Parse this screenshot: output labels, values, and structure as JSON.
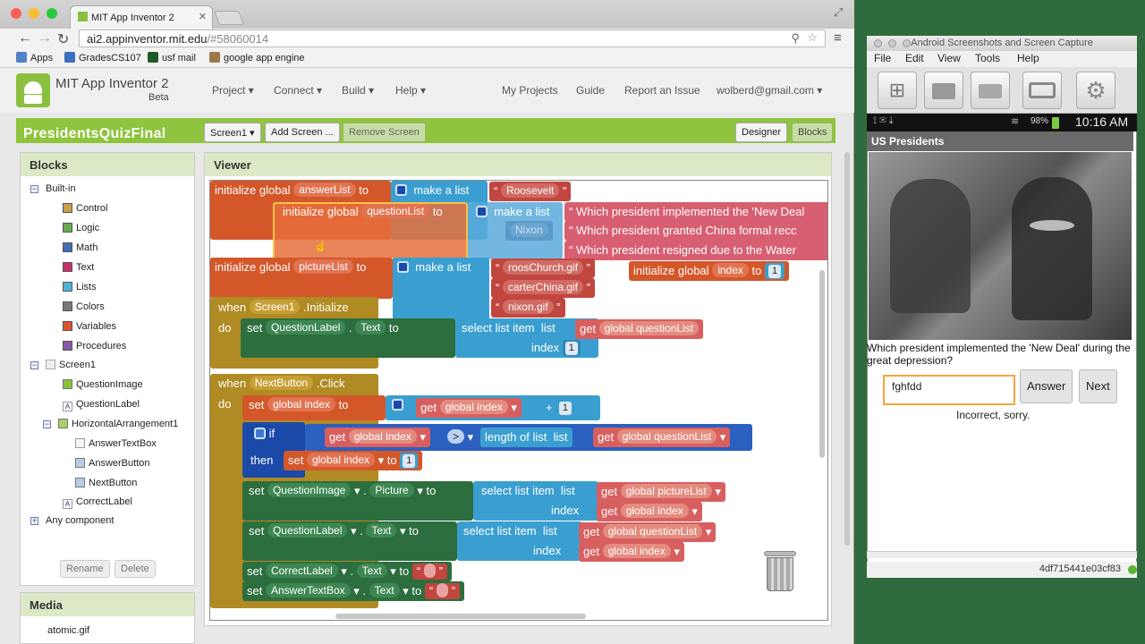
{
  "browser": {
    "tab_title": "MIT App Inventor 2",
    "url_host": "ai2.appinventor.mit.edu",
    "url_path": "/#58060014",
    "bookmarks": [
      "Apps",
      "GradesCS107",
      "usf mail",
      "google app engine"
    ]
  },
  "app": {
    "logo_title": "MIT App Inventor 2",
    "logo_beta": "Beta",
    "menus": [
      "Project ▾",
      "Connect ▾",
      "Build ▾",
      "Help ▾"
    ],
    "links": [
      "My Projects",
      "Guide",
      "Report an Issue",
      "wolberd@gmail.com ▾"
    ]
  },
  "project": {
    "name": "PresidentsQuizFinal",
    "screen_select": "Screen1 ▾",
    "add_screen": "Add Screen ...",
    "remove_screen": "Remove Screen",
    "designer": "Designer",
    "blocks": "Blocks"
  },
  "blocks_panel": {
    "title": "Blocks",
    "builtin": "Built-in",
    "builtin_items": [
      {
        "label": "Control",
        "color": "#c8a04a"
      },
      {
        "label": "Logic",
        "color": "#6aa84f"
      },
      {
        "label": "Math",
        "color": "#3f6fb5"
      },
      {
        "label": "Text",
        "color": "#c8316b"
      },
      {
        "label": "Lists",
        "color": "#4fb1d6"
      },
      {
        "label": "Colors",
        "color": "#7a7a7a"
      },
      {
        "label": "Variables",
        "color": "#d8542a"
      },
      {
        "label": "Procedures",
        "color": "#8a5aa6"
      }
    ],
    "screen": "Screen1",
    "components": [
      "QuestionImage",
      "QuestionLabel",
      "HorizontalArrangement1",
      "AnswerTextBox",
      "AnswerButton",
      "NextButton",
      "CorrectLabel"
    ],
    "any_component": "Any component",
    "rename": "Rename",
    "delete": "Delete"
  },
  "media_panel": {
    "title": "Media",
    "items": [
      "atomic.gif"
    ]
  },
  "viewer": {
    "title": "Viewer",
    "blocks": {
      "init_answer": "initialize global",
      "answer_var": "answerList",
      "to": "to",
      "make_list": "make a list",
      "roosevelt": "Roosevelt",
      "question_var": "questionList",
      "nixon": "Nixon",
      "q1": "Which president implemented the 'New Deal",
      "q2": "Which president granted China formal recc",
      "q3": "Which president resigned due to the Water",
      "picture_var": "pictureList",
      "pic1": "roosChurch.gif",
      "pic2": "carterChina.gif",
      "pic3": "nixon.gif",
      "index_var": "index",
      "one": "1",
      "when": "when",
      "do": "do",
      "screen1": "Screen1",
      "initialize_event": ".Initialize",
      "set": "set",
      "question_label": "QuestionLabel",
      "text_prop": "Text",
      "select_list_item": "select list item",
      "list": "list",
      "index": "index",
      "get": "get",
      "global_questionlist": "global questionList",
      "global_index": "global index",
      "global_picturelist": "global pictureList",
      "next_button": "NextButton",
      "click_event": ".Click",
      "plus": "+",
      "if": "if",
      "then": "then",
      "gt": ">",
      "length_of_list": "length of list",
      "question_image": "QuestionImage",
      "picture_prop": "Picture",
      "correct_label": "CorrectLabel",
      "answer_textbox": "AnswerTextBox",
      "quote_open": "“",
      "quote_close": "”"
    }
  },
  "emulator": {
    "window_title": "Android Screenshots and Screen Capture",
    "menus": [
      "File",
      "Edit",
      "View",
      "Tools",
      "Help"
    ],
    "battery": "98%",
    "time": "10:16 AM",
    "app_title": "US Presidents",
    "question": "Which president implemented the 'New Deal' during the great depression?",
    "answer_value": "fghfdd",
    "answer_button": "Answer",
    "next_button": "Next",
    "result": "Incorrect, sorry.",
    "device_id": "4df715441e03cf83"
  }
}
